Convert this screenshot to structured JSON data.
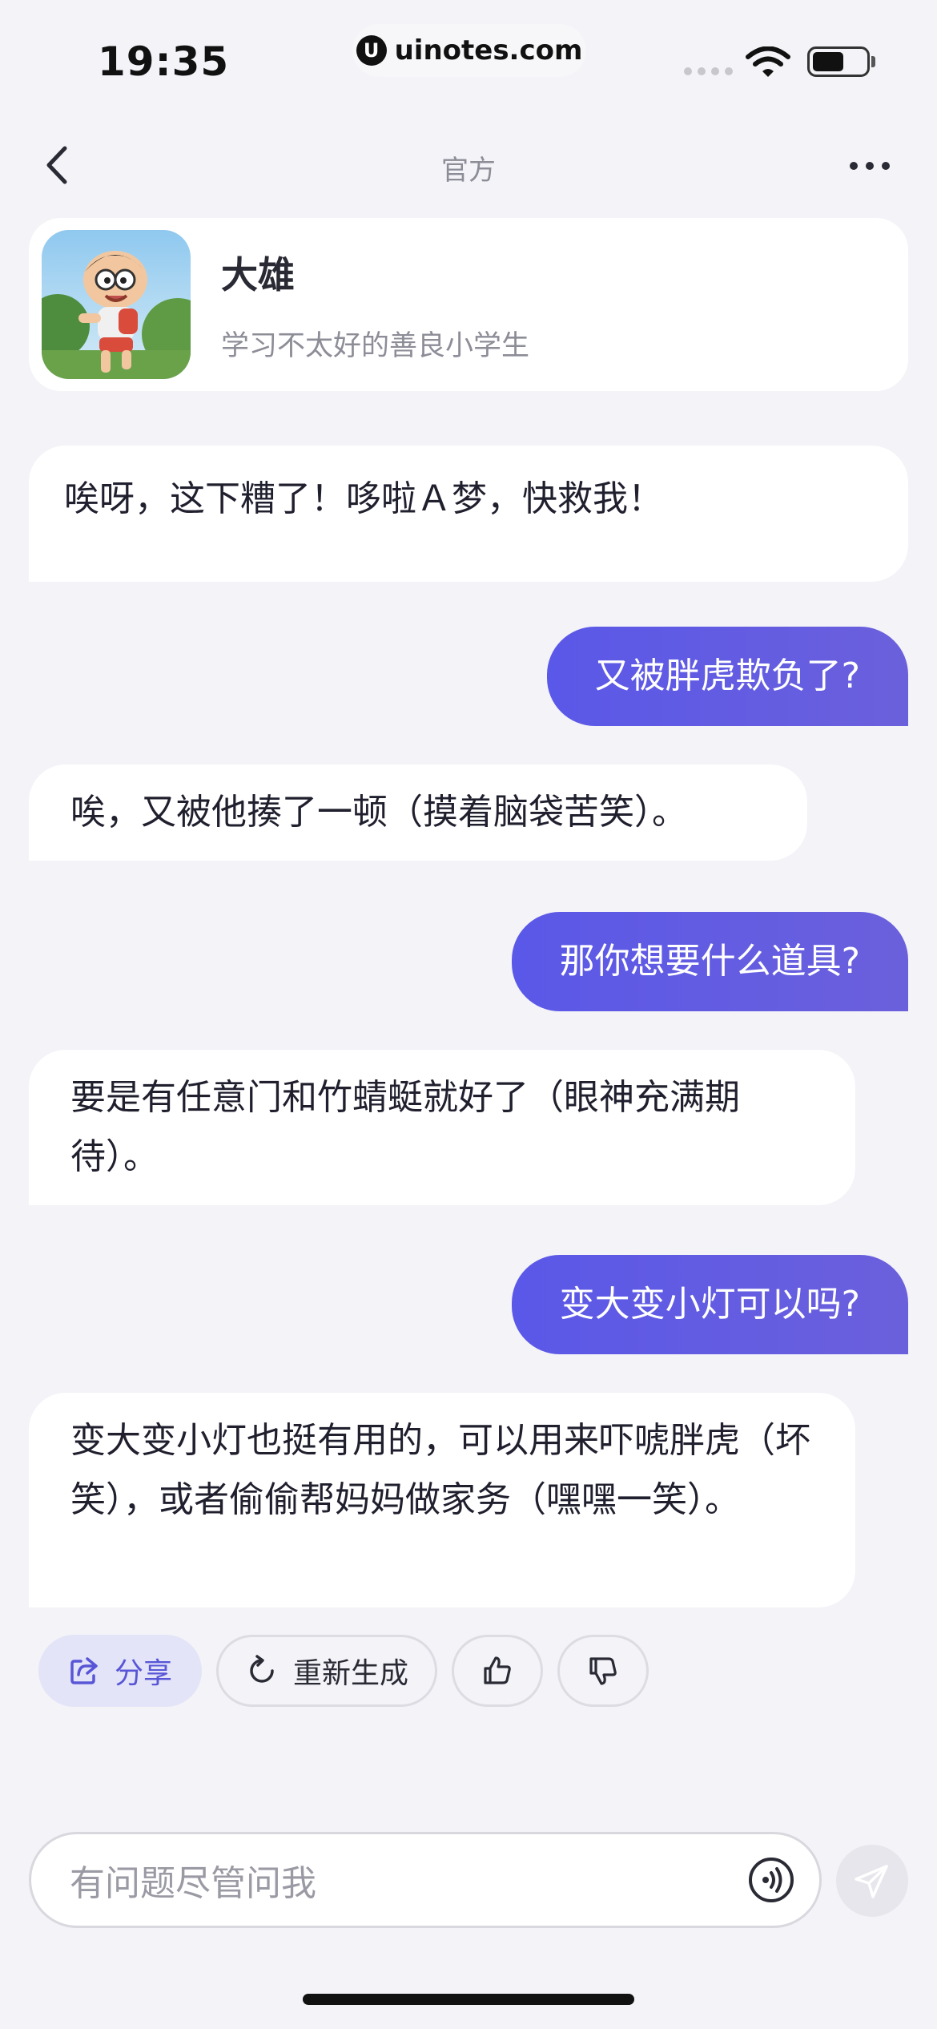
{
  "status_bar": {
    "time": "19:35",
    "site": "uinotes.com"
  },
  "nav": {
    "title": "官方"
  },
  "profile": {
    "name": "大雄",
    "description": "学习不太好的善良小学生"
  },
  "messages": [
    {
      "role": "bot",
      "text": "唉呀，这下糟了！哆啦Ａ梦，快救我！"
    },
    {
      "role": "user",
      "text": "又被胖虎欺负了?"
    },
    {
      "role": "bot",
      "text": "唉，又被他揍了一顿（摸着脑袋苦笑）。"
    },
    {
      "role": "user",
      "text": "那你想要什么道具?"
    },
    {
      "role": "bot",
      "text": "要是有任意门和竹蜻蜓就好了（眼神充满期待）。"
    },
    {
      "role": "user",
      "text": "变大变小灯可以吗?"
    },
    {
      "role": "bot",
      "text": "变大变小灯也挺有用的，可以用来吓唬胖虎（坏笑），或者偷偷帮妈妈做家务（嘿嘿一笑）。"
    }
  ],
  "actions": {
    "share": "分享",
    "regenerate": "重新生成"
  },
  "input": {
    "placeholder": "有问题尽管问我"
  },
  "colors": {
    "accent": "#5a58e8",
    "background": "#f3f3f8"
  }
}
